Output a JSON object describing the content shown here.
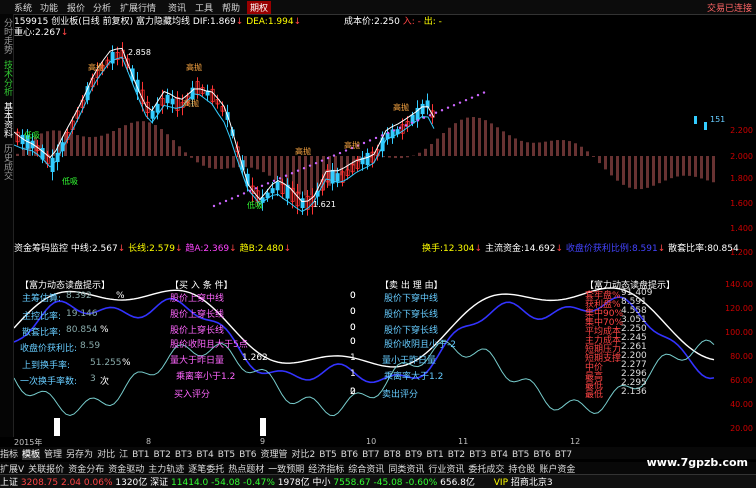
{
  "menubar": {
    "items": [
      "系统",
      "功能",
      "报价",
      "分析",
      "扩展行情",
      "资讯",
      "工具",
      "帮助",
      "期权"
    ],
    "active_index": 8,
    "right_text": "交易已连接"
  },
  "lefttabs": [
    "分时走势",
    "技术分析",
    "基本资料",
    "历史成交"
  ],
  "infoline": {
    "code": "159915",
    "name": "创业板(日线 前复权)",
    "indicator": "富力隐藏均线",
    "dif_label": "DIF:",
    "dif_value": "1.869",
    "dea_label": "DEA:",
    "dea_value": "1.994",
    "cost_label": "成本价:",
    "cost_value": "2.250",
    "in_label": "入:",
    "out_label": "出:",
    "center_label": "重心:",
    "center_value": "2.267"
  },
  "chart_labels": {
    "high_price": "2.858",
    "low_price": "1.621",
    "high_sell": "高抛",
    "low_buy": "低吸",
    "right_value": "151"
  },
  "axis_right": [
    "2.200",
    "2.000",
    "1.800",
    "1.600",
    "1.400",
    "1.200",
    "140.00",
    "120.00",
    "100.00",
    "80.00",
    "60.00",
    "40.00",
    "20.00"
  ],
  "midbar": {
    "label": "资金筹码监控",
    "mid_label": "中线:",
    "mid_value": "2.567",
    "long_label": "长线:",
    "long_value": "2.579",
    "a_label": "趋A:",
    "a_value": "2.369",
    "b_label": "趋B:",
    "b_value": "2.480",
    "turnover_label": "换手:",
    "turnover_value": "12.304",
    "main_label": "主流资金:",
    "main_value": "14.692",
    "profit_label": "收盘价获利比例:",
    "profit_value": "8.591",
    "lock_label": "散套比率:",
    "lock_value": "80.854"
  },
  "panel_left": {
    "title": "【富力动态读盘提示】",
    "rows": [
      {
        "label": "主筹估算:",
        "value": "8.392",
        "unit": "%"
      },
      {
        "label": "主控比率:",
        "value": "19.146",
        "unit": ""
      },
      {
        "label": "散套比率:",
        "value": "80.854",
        "unit": "%"
      },
      {
        "label": "收盘价获利比:",
        "value": "8.59",
        "unit": ""
      },
      {
        "label": "上到换手率:",
        "value": "51.255",
        "unit": "%"
      },
      {
        "label": "一次换手率数:",
        "value": "3",
        "unit": "次"
      }
    ]
  },
  "panel_buy": {
    "title": "【买 入 条 件】",
    "rows": [
      {
        "label": "股价上穿中线",
        "value": "0"
      },
      {
        "label": "股价上穿长线",
        "value": "0"
      },
      {
        "label": "股价上穿长线",
        "value": "0"
      },
      {
        "label": "股价收阳且大于5点",
        "value": "0"
      },
      {
        "label": "量大于昨日量",
        "value": "1.262"
      },
      {
        "label": "乘离率小于1.2",
        "value": ""
      },
      {
        "label": "买入评分",
        "value": "0"
      }
    ]
  },
  "panel_sell": {
    "title": "【卖 出 理 由】",
    "rows": [
      {
        "label": "股价下穿中线",
        "value": "0"
      },
      {
        "label": "股价下穿长线",
        "value": "0"
      },
      {
        "label": "股价下穿长线",
        "value": "0"
      },
      {
        "label": "股价收阴且小于-2",
        "value": "0"
      },
      {
        "label": "量小于昨日量",
        "value": "1"
      },
      {
        "label": "乘离率大于1.2",
        "value": "1"
      },
      {
        "label": "卖出评分",
        "value": "2"
      }
    ]
  },
  "panel_right": {
    "title": "【富力动态读盘提示】",
    "rows": [
      {
        "label": "套牢盘%",
        "value": "91.409"
      },
      {
        "label": "获利盘%",
        "value": "8.591"
      },
      {
        "label": "集中90%",
        "value": "4.558"
      },
      {
        "label": "集中70%",
        "value": "3.051"
      },
      {
        "label": "平均成本",
        "value": "2.250"
      },
      {
        "label": "主力成本",
        "value": "2.245"
      },
      {
        "label": "短期压力",
        "value": "2.261"
      },
      {
        "label": "短期支撑",
        "value": "2.200"
      },
      {
        "label": "中价",
        "value": "2.277"
      },
      {
        "label": "最高",
        "value": "2.296"
      },
      {
        "label": "最低",
        "value": "2.295"
      },
      {
        "label": "最低",
        "value": "2.136"
      }
    ]
  },
  "dates": [
    "2015年",
    "8",
    "9",
    "10",
    "11",
    "12"
  ],
  "bottom_tabs": [
    "指标",
    "模板",
    "管理",
    "另存为",
    "对比",
    "江",
    "BT1",
    "BT2",
    "BT3",
    "BT4",
    "BT5",
    "BT6",
    "资理管",
    "对比2",
    "BT5",
    "BT6",
    "BT7",
    "BT8",
    "BT9",
    "BT1",
    "BT2",
    "BT3",
    "BT4",
    "BT5",
    "BT6",
    "BT7"
  ],
  "bottom_tabs2": [
    "扩展V",
    "关联报价",
    "资金分布",
    "资金驱动",
    "主力轨迹",
    "逐笔委托",
    "热点题材",
    "一致预期",
    "经济指标",
    "综合资讯",
    "同类资讯",
    "行业资讯",
    "委托成交",
    "持仓股",
    "账户资金"
  ],
  "status": {
    "sh_label": "上证",
    "sh_value": "3208.75",
    "sh_change": "2.04",
    "sh_pct": "0.06%",
    "sh_amount": "1320亿",
    "sz_label": "深证",
    "sz_value": "11414.0",
    "sz_change": "-54.08",
    "sz_pct": "-0.47%",
    "sz_amount": "1978亿",
    "zx_label": "中小",
    "zx_value": "7558.67",
    "zx_change": "-45.08",
    "zx_pct": "-0.60%",
    "zx_amount": "656.8亿",
    "vip_label": "VIP",
    "vip_value": "招商北京3"
  },
  "watermark": "www.7gpzb.com"
}
